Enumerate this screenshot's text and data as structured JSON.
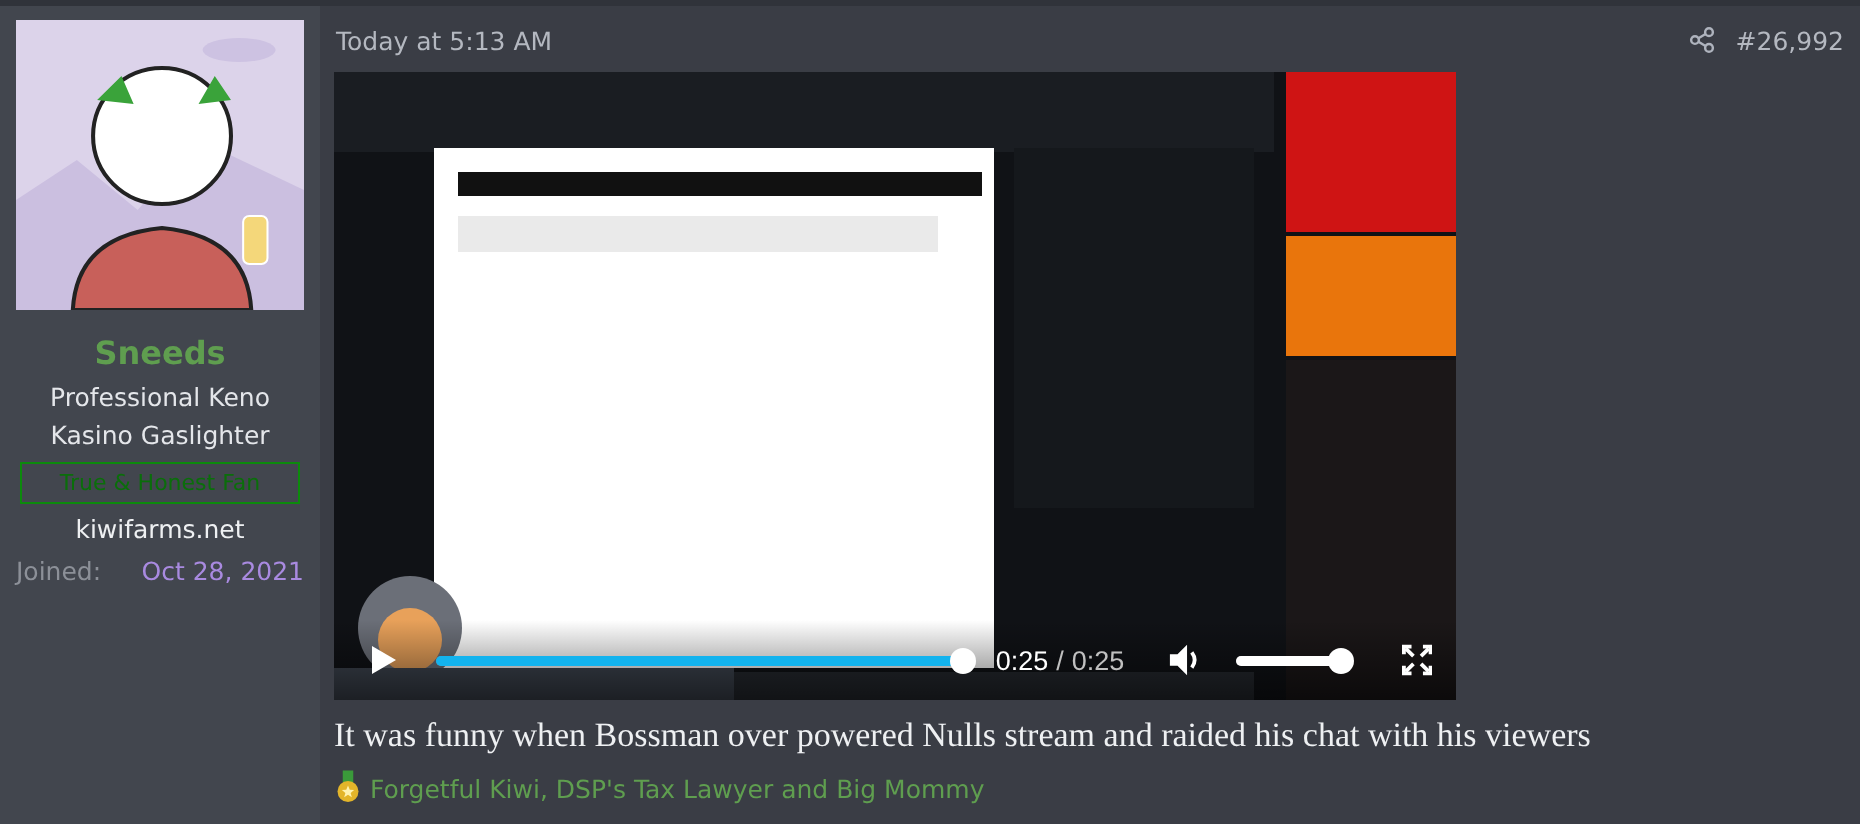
{
  "user": {
    "name": "Sneeds",
    "title": "Professional Keno Kasino Gaslighter",
    "banner": "True & Honest Fan",
    "site": "kiwifarms.net",
    "joined_label": "Joined:",
    "joined_date": "Oct 28, 2021"
  },
  "post": {
    "timestamp": "Today at 5:13 AM",
    "number": "#26,992",
    "video": {
      "kind": "picture",
      "playing": false,
      "progress": {
        "level": 1
      },
      "time_current": "0:25",
      "time_separator": "/",
      "time_total": "0:25",
      "volume": {
        "level": 1
      }
    },
    "body": "It was funny when Bossman over powered Nulls stream and raided his chat with his viewers",
    "reactions": "Forgetful Kiwi, DSP's Tax Lawyer and Big Mommy"
  }
}
